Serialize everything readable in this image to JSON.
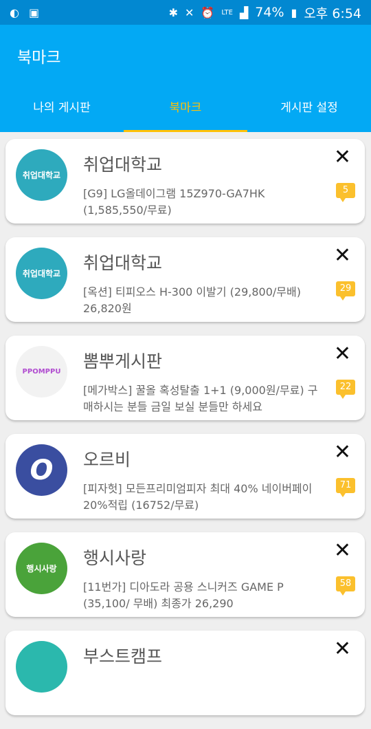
{
  "status_bar": {
    "battery": "74%",
    "time": "오후 6:54",
    "network": "LTE"
  },
  "app_bar": {
    "title": "북마크"
  },
  "tabs": [
    {
      "label": "나의 게시판"
    },
    {
      "label": "북마크",
      "active": true
    },
    {
      "label": "게시판 설정"
    }
  ],
  "colors": {
    "accent": "#ffc107",
    "app_bar": "#03a9f4",
    "status_bar": "#0288d1",
    "badge": "#fbc02d"
  },
  "bookmarks": [
    {
      "board": "취업대학교",
      "logo_text": "취업대학교",
      "logo_color": "#2eaabd",
      "title": "[G9] LG올데이그램 15Z970-GA7HK (1,585,550/무료)",
      "comments": "5"
    },
    {
      "board": "취업대학교",
      "logo_text": "취업대학교",
      "logo_color": "#2eaabd",
      "title": "[옥션] 티피오스 H-300 이발기 (29,800/무배) 26,820원",
      "comments": "29"
    },
    {
      "board": "뽐뿌게시판",
      "logo_text": "PPOMPPU",
      "logo_color": "#f2f2f2",
      "title": "[메가박스] 꿀올 혹성탈출 1+1 (9,000원/무료) 구매하시는 분들 금일 보실 분들만 하세요",
      "comments": "22"
    },
    {
      "board": "오르비",
      "logo_text": "O",
      "logo_color": "#3a4ea0",
      "title": "[피자헛] 모든프리미엄피자 최대 40% 네이버페이 20%적립 (16752/무료)",
      "comments": "71"
    },
    {
      "board": "행시사랑",
      "logo_text": "행시사랑",
      "logo_color": "#4aa33a",
      "title": "[11번가] 디아도라 공용 스니커즈 GAME P (35,100/ 무배) 최종가 26,290",
      "comments": "58"
    },
    {
      "board": "부스트캠프",
      "logo_text": "",
      "logo_color": "#2bb8ad",
      "title": "",
      "comments": ""
    }
  ]
}
